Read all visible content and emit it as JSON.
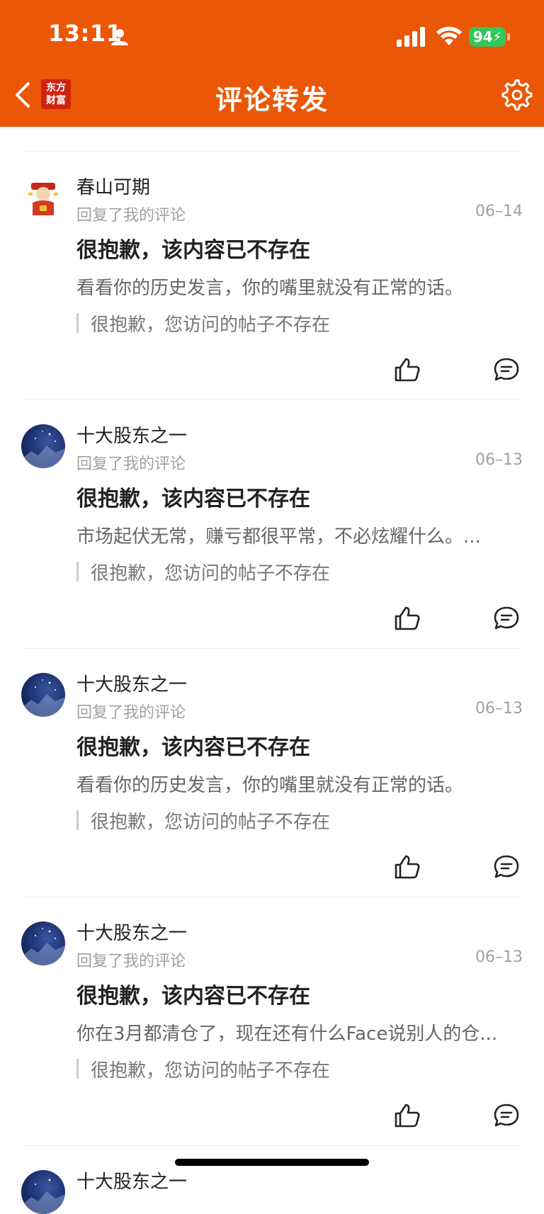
{
  "status_bar": {
    "time": "13:11",
    "battery": "94"
  },
  "header": {
    "title": "评论转发",
    "logo_line1": "东方",
    "logo_line2": "财富"
  },
  "colors": {
    "accent": "#ea5706",
    "battery_green": "#34c759"
  },
  "comments": [
    {
      "name": "春山可期",
      "subtitle": "回复了我的评论",
      "date": "06–14",
      "headline": "很抱歉，该内容已不存在",
      "content": "看看你的历史发言，你的嘴里就没有正常的话。",
      "quote": "很抱歉，您访问的帖子不存在"
    },
    {
      "name": "十大股东之一",
      "subtitle": "回复了我的评论",
      "date": "06–13",
      "headline": "很抱歉，该内容已不存在",
      "content": "市场起伏无常，赚亏都很平常，不必炫耀什么。...",
      "quote": "很抱歉，您访问的帖子不存在"
    },
    {
      "name": "十大股东之一",
      "subtitle": "回复了我的评论",
      "date": "06–13",
      "headline": "很抱歉，该内容已不存在",
      "content": "看看你的历史发言，你的嘴里就没有正常的话。",
      "quote": "很抱歉，您访问的帖子不存在"
    },
    {
      "name": "十大股东之一",
      "subtitle": "回复了我的评论",
      "date": "06–13",
      "headline": "很抱歉，该内容已不存在",
      "content": "你在3月都清仓了，现在还有什么Face说别人的仓...",
      "quote": "很抱歉，您访问的帖子不存在"
    },
    {
      "name": "十大股东之一"
    }
  ]
}
